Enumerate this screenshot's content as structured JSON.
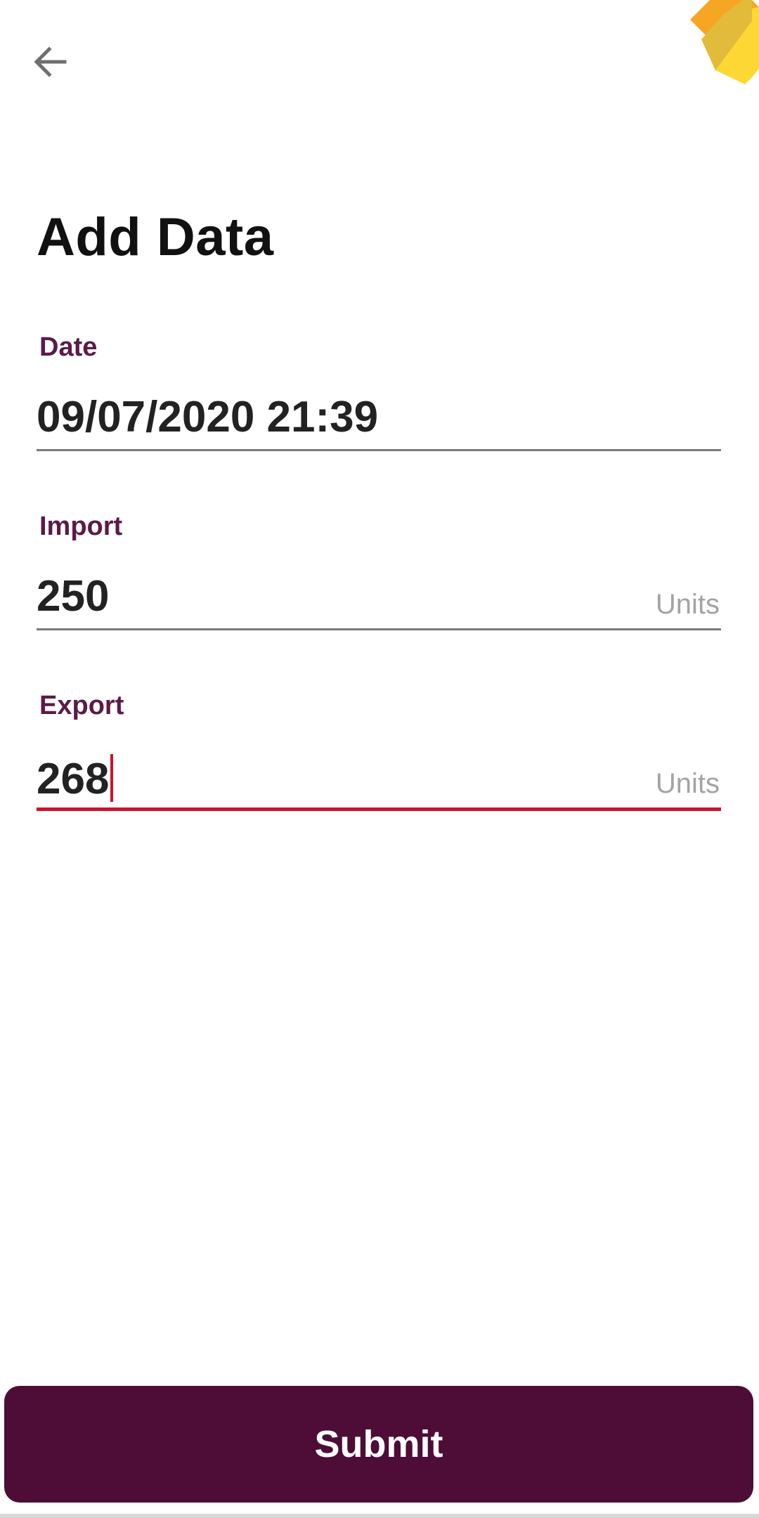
{
  "header": {
    "back_icon": "arrow-left-icon",
    "decor_icon": "sun-badge-icon",
    "colors": {
      "decor_orange": "#f6a623",
      "decor_yellow": "#fdd835",
      "decor_dark_yellow": "#e2bb3a"
    }
  },
  "page": {
    "title": "Add Data"
  },
  "form": {
    "date": {
      "label": "Date",
      "value": "09/07/2020 21:39"
    },
    "import": {
      "label": "Import",
      "value": "250",
      "unit": "Units"
    },
    "export": {
      "label": "Export",
      "value": "268",
      "unit": "Units",
      "focused": true
    }
  },
  "actions": {
    "submit_label": "Submit"
  },
  "colors": {
    "label": "#5c1a47",
    "button_bg": "#4d0d37",
    "focus_underline": "#d0112b",
    "unit_text": "#a3a3a3"
  }
}
